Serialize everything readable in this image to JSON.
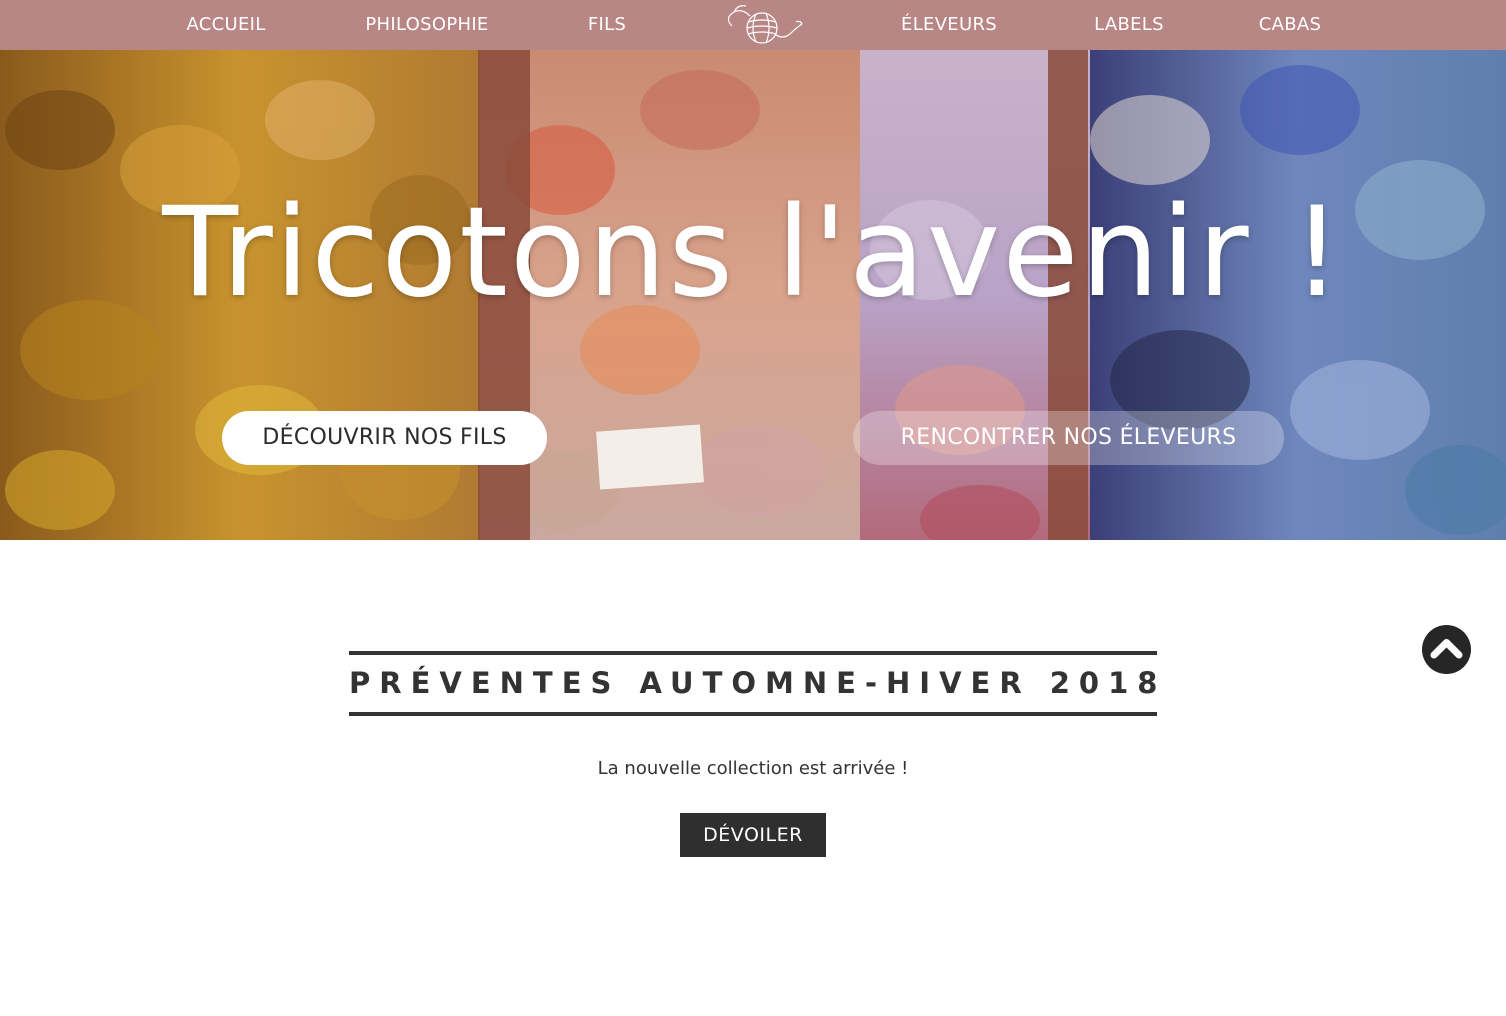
{
  "nav": {
    "items_left": [
      {
        "label": "ACCUEIL"
      },
      {
        "label": "PHILOSOPHIE"
      },
      {
        "label": "FILS"
      }
    ],
    "items_right": [
      {
        "label": "ÉLEVEURS"
      },
      {
        "label": "LABELS"
      },
      {
        "label": "CABAS"
      }
    ],
    "logo_icon": "yarn-ball-logo-icon"
  },
  "hero": {
    "title": "Tricotons l'avenir !",
    "primary_button": "DÉCOUVRIR NOS FILS",
    "secondary_button": "RENCONTRER NOS ÉLEVEURS"
  },
  "presale": {
    "title": "PRÉVENTES AUTOMNE-HIVER 2018",
    "subtitle": "La nouvelle collection est arrivée !",
    "button": "DÉVOILER"
  },
  "scroll_top_icon": "chevron-up-icon",
  "colors": {
    "nav_bg": "#b78685",
    "dark": "#2f2f2f",
    "text": "#333333"
  }
}
